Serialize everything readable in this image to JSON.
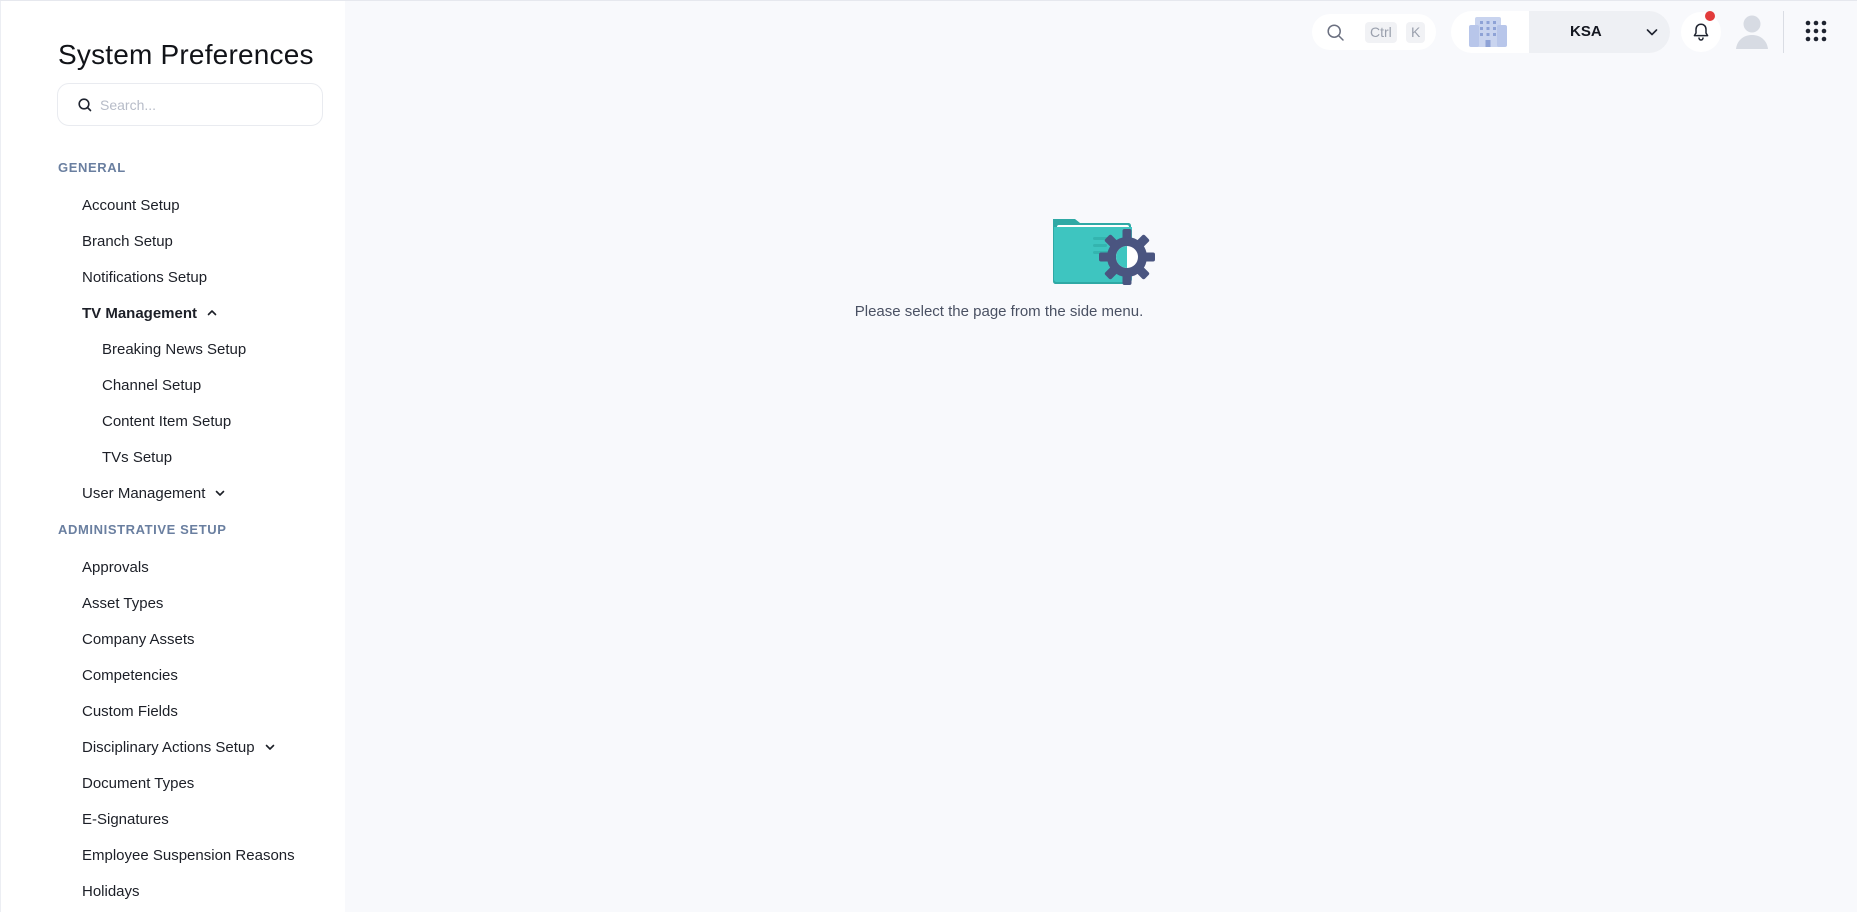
{
  "sidebar": {
    "title": "System Preferences",
    "search_placeholder": "Search...",
    "sections": [
      {
        "label": "GENERAL",
        "items": [
          {
            "label": "Account Setup"
          },
          {
            "label": "Branch Setup"
          },
          {
            "label": "Notifications Setup"
          },
          {
            "label": "TV Management",
            "expanded": true,
            "children": [
              {
                "label": "Breaking News Setup"
              },
              {
                "label": "Channel Setup"
              },
              {
                "label": "Content Item Setup"
              },
              {
                "label": "TVs Setup"
              }
            ]
          },
          {
            "label": "User Management",
            "expanded": false
          }
        ]
      },
      {
        "label": "ADMINISTRATIVE SETUP",
        "items": [
          {
            "label": "Approvals"
          },
          {
            "label": "Asset Types"
          },
          {
            "label": "Company Assets"
          },
          {
            "label": "Competencies"
          },
          {
            "label": "Custom Fields"
          },
          {
            "label": "Disciplinary Actions Setup",
            "expanded": false
          },
          {
            "label": "Document Types"
          },
          {
            "label": "E-Signatures"
          },
          {
            "label": "Employee Suspension Reasons"
          },
          {
            "label": "Holidays"
          }
        ]
      }
    ]
  },
  "topbar": {
    "search_shortcut": [
      "Ctrl",
      "K"
    ],
    "company": "KSA",
    "icons": {
      "search": "search-icon",
      "building": "building-icon",
      "bell": "bell-icon",
      "avatar": "avatar-icon",
      "apps": "apps-grid-icon"
    }
  },
  "main": {
    "empty_message": "Please select the page from the side menu."
  },
  "colors": {
    "accent_teal": "#3ec5c0",
    "gear": "#4a5580",
    "section_label": "#6a7fa0",
    "notification_dot": "#e23b3b",
    "main_bg": "#f8f9fc"
  }
}
